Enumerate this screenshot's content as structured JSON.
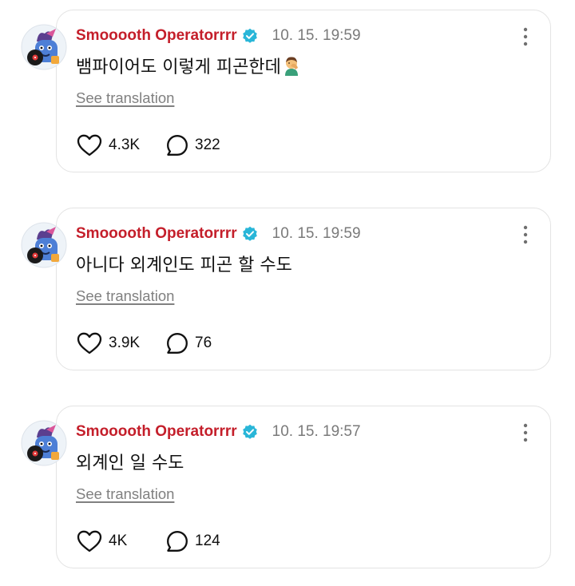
{
  "posts": [
    {
      "username": "Smooooth Operatorrrr",
      "timestamp": "10. 15. 19:59",
      "text": "뱀파이어도 이렇게 피곤한데",
      "emoji": "man-facepalming-emoji",
      "translate_label": "See translation",
      "likes": "4.3K",
      "replies": "322"
    },
    {
      "username": "Smooooth Operatorrrr",
      "timestamp": "10. 15. 19:59",
      "text": "아니다 외계인도 피곤 할 수도",
      "translate_label": "See translation",
      "likes": "3.9K",
      "replies": "76"
    },
    {
      "username": "Smooooth Operatorrrr",
      "timestamp": "10. 15. 19:57",
      "text": "외계인 일 수도",
      "translate_label": "See translation",
      "likes": "4K",
      "replies": "124"
    }
  ],
  "icons": {
    "verified": "verified-badge-icon",
    "more": "more-vertical-icon",
    "like": "heart-icon",
    "reply": "speech-bubble-icon"
  },
  "colors": {
    "username": "#c41e2a",
    "verified_badge": "#29b6d8",
    "timestamp": "#7a7a7a",
    "translate_link": "#808080",
    "card_border": "#e3e3e3"
  }
}
